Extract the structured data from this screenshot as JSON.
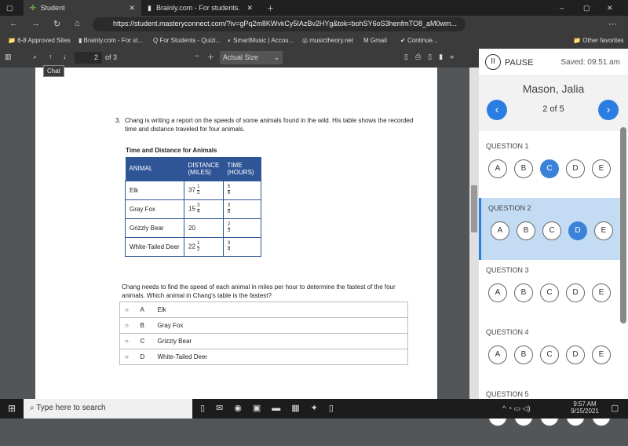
{
  "browser": {
    "tabs": [
      {
        "title": "Student"
      },
      {
        "title": "Brainly.com - For students. By st"
      }
    ],
    "url": "https://student.masteryconnect.com/?iv=gPq2m8KWvkCy5IAzBv2HYg&tok=bohSY6oS3henfmTO8_aM0wm...",
    "bookmarks": [
      "6-8 Approved Sites",
      "Brainly.com - For st...",
      "For Students - Quizi...",
      "SmartMusic | Accou...",
      "musictheory.net",
      "Gmail",
      "Continue..."
    ],
    "other_favorites": "Other favorites"
  },
  "pdf": {
    "page": "2",
    "of": "of 3",
    "zoom": "Actual Size",
    "tooltip": "Chat"
  },
  "question": {
    "number": "3.",
    "text": "Chang is writing a report on the speeds of some animals found in the wild. His table shows the recorded time and distance traveled for four animals.",
    "table_title": "Time and Distance for Animals",
    "headers": [
      "ANIMAL",
      "DISTANCE (MILES)",
      "TIME (HOURS)"
    ],
    "rows": [
      {
        "animal": "Elk",
        "whole": "37",
        "num": "1",
        "den": "2",
        "tnum": "5",
        "tden": "6"
      },
      {
        "animal": "Gray Fox",
        "whole": "15",
        "num": "3",
        "den": "4",
        "tnum": "3",
        "tden": "8"
      },
      {
        "animal": "Grizzly Bear",
        "whole": "20",
        "num": "",
        "den": "",
        "tnum": "2",
        "tden": "3"
      },
      {
        "animal": "White-Tailed Deer",
        "whole": "22",
        "num": "1",
        "den": "2",
        "tnum": "3",
        "tden": "4"
      }
    ],
    "prompt": "Chang needs to find the speed of each animal in miles per hour to determine the fastest of the four animals. Which animal in Chang's table is the fastest?",
    "options": [
      {
        "letter": "A",
        "text": "Elk"
      },
      {
        "letter": "B",
        "text": "Gray Fox"
      },
      {
        "letter": "C",
        "text": "Grizzly Bear"
      },
      {
        "letter": "D",
        "text": "White-Tailed Deer"
      }
    ]
  },
  "panel": {
    "pause": "PAUSE",
    "saved": "Saved: 09:51 am",
    "student": "Mason, Jalia",
    "position": "2 of 5",
    "accent": "#3b82d9",
    "highlight": "#c3dcf3",
    "questions": [
      {
        "label": "QUESTION 1",
        "selected": "C"
      },
      {
        "label": "QUESTION 2",
        "selected": "D"
      },
      {
        "label": "QUESTION 3",
        "selected": ""
      },
      {
        "label": "QUESTION 4",
        "selected": ""
      },
      {
        "label": "QUESTION 5",
        "selected": ""
      }
    ],
    "letters": [
      "A",
      "B",
      "C",
      "D",
      "E"
    ]
  },
  "taskbar": {
    "search": "Type here to search",
    "time": "9:57 AM",
    "date": "9/15/2021"
  }
}
